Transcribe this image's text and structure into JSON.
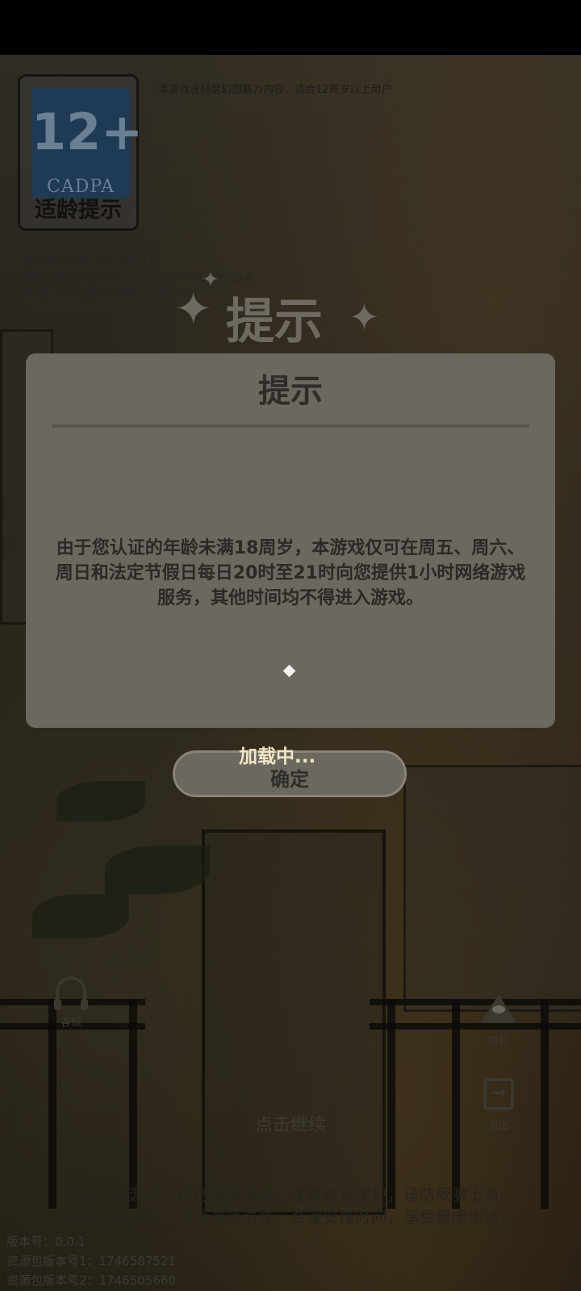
{
  "age_rating": {
    "number": "12+",
    "org": "CADPA",
    "label": "适龄提示",
    "notice": "本游戏含轻度幻想暴力内容，适合12周岁以上用户"
  },
  "license": {
    "icp": "蜀ICP备2025130114号-1A",
    "publication": "浙新出游[2024]65号 ISBN978-7-498-13958-0",
    "copyright": "著作权人：成都空在社科技有限公司"
  },
  "screen_title": "提示",
  "dialog": {
    "title": "提示",
    "message": "由于您认证的年龄未满18周岁，本游戏仅可在周五、周六、周日和法定节假日每日20时至21时向您提供1小时网络游戏服务，其他时间均不得进入游戏。"
  },
  "confirm_button": {
    "label": "确定"
  },
  "loading_text": "加载中...",
  "side_buttons": {
    "service": "客服",
    "privacy": "隐私",
    "exit": "退出"
  },
  "tap_continue": "点击继续",
  "health_warning": {
    "line1": "抵制不良游戏，拒绝盗版游戏，注意自我保护，谨防受骗上当。",
    "line2": "适度游戏益脑，沉迷游戏伤身，合理安排时间，享受健康生活。"
  },
  "version": {
    "app": "版本号：0.0.1",
    "res1": "资源包版本号1：1746587521",
    "res2": "资源包版本号2：1746505660"
  },
  "colors": {
    "dialog_bg": "#6b6860",
    "loading_text": "#f1e6c6"
  },
  "icons": {
    "service": "headset-icon",
    "privacy": "eye-icon",
    "exit": "exit-icon",
    "sparkle": "sparkle-icon"
  }
}
